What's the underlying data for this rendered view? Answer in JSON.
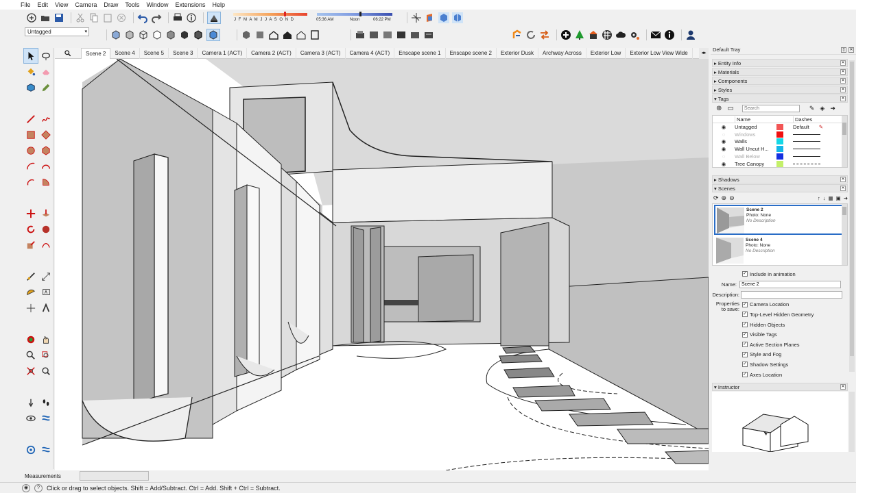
{
  "menu": [
    "File",
    "Edit",
    "View",
    "Camera",
    "Draw",
    "Tools",
    "Window",
    "Extensions",
    "Help"
  ],
  "shadow": {
    "months": "J F M A M J J A S O N D",
    "time_start": "05:36 AM",
    "time_mid": "Noon",
    "time_end": "06:22 PM"
  },
  "tag_select": "Untagged",
  "scene_tabs": [
    "Scene 2",
    "Scene 4",
    "Scene 5",
    "Scene 3",
    "Camera 1 (ACT)",
    "Camera 2 (ACT)",
    "Camera 3 (ACT)",
    "Camera 4 (ACT)",
    "Enscape scene 1",
    "Enscape scene 2",
    "Exterior Dusk",
    "Archway Across",
    "Exterior Low",
    "Exterior Low View Wide"
  ],
  "tray": {
    "title": "Default Tray",
    "sections_top": [
      "Entity Info",
      "Materials",
      "Components",
      "Styles"
    ],
    "tags_title": "Tags",
    "search_placeholder": "Search",
    "col_name": "Name",
    "col_dashes": "Dashes",
    "tags": [
      {
        "name": "Untagged",
        "color": "#f25555",
        "dash": "Default",
        "visible": true
      },
      {
        "name": "Windows",
        "color": "#f01010",
        "dash": "solid",
        "visible": false
      },
      {
        "name": "Walls",
        "color": "#14d8e6",
        "dash": "solid",
        "visible": true
      },
      {
        "name": "Wall Uncut H...",
        "color": "#13b7e8",
        "dash": "solid",
        "visible": true
      },
      {
        "name": "Wall Below",
        "color": "#1530e0",
        "dash": "solid",
        "visible": false
      },
      {
        "name": "Tree Canopy",
        "color": "#c4f06a",
        "dash": "dashed",
        "visible": true
      }
    ],
    "shadows_title": "Shadows",
    "scenes_title": "Scenes",
    "scene_list": [
      {
        "name": "Scene 2",
        "photo": "Photo: None",
        "desc": "No Description"
      },
      {
        "name": "Scene 4",
        "photo": "Photo: None",
        "desc": "No Description"
      }
    ],
    "include_animation": "Include in animation",
    "name_label": "Name:",
    "name_value": "Scene 2",
    "desc_label": "Description:",
    "props_label": "Properties to save:",
    "props": [
      "Camera Location",
      "Top-Level Hidden Geometry",
      "Hidden Objects",
      "Visible Tags",
      "Active Section Planes",
      "Style and Fog",
      "Shadow Settings",
      "Axes Location"
    ],
    "instructor_title": "Instructor"
  },
  "measurements_label": "Measurements",
  "status_text": "Click or drag to select objects. Shift = Add/Subtract. Ctrl = Add. Shift + Ctrl = Subtract.",
  "colors": {
    "accent": "#2a6dc6",
    "selected_tool": "#cfe3f7"
  }
}
